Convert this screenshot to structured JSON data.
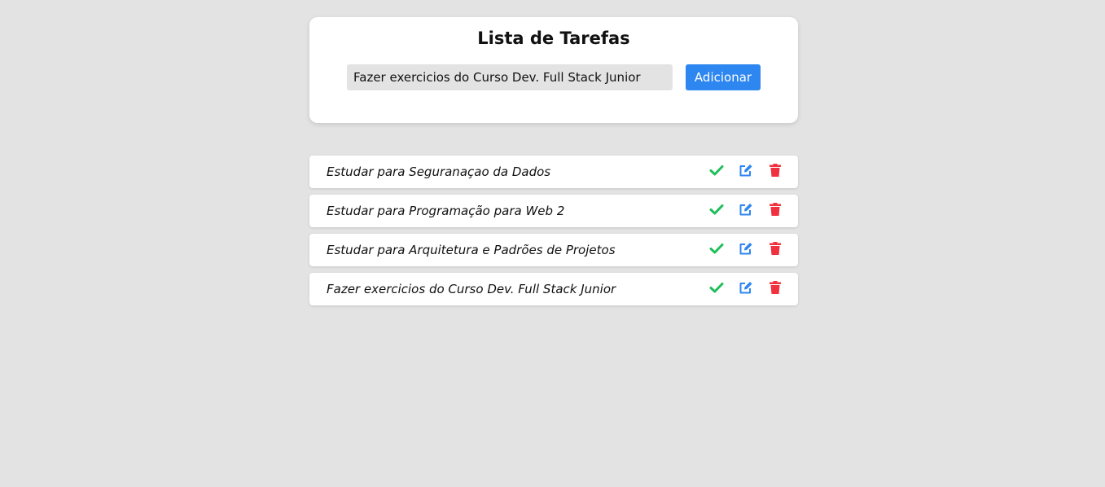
{
  "header": {
    "title": "Lista de Tarefas",
    "input_value": "Fazer exercicios do Curso Dev. Full Stack Junior",
    "add_label": "Adicionar"
  },
  "tasks": [
    {
      "text": "Estudar para Seguranaçao da Dados"
    },
    {
      "text": "Estudar para Programação para Web 2"
    },
    {
      "text": "Estudar para Arquitetura e Padrões de Projetos"
    },
    {
      "text": "Fazer exercicios do Curso Dev. Full Stack Junior"
    }
  ],
  "icons": {
    "complete": "check-icon",
    "edit": "edit-icon",
    "delete": "trash-icon"
  },
  "colors": {
    "background": "#e3e3e3",
    "primary": "#2e86f0",
    "check": "#1fbf5a",
    "edit": "#2e86f0",
    "delete": "#f0313f"
  }
}
